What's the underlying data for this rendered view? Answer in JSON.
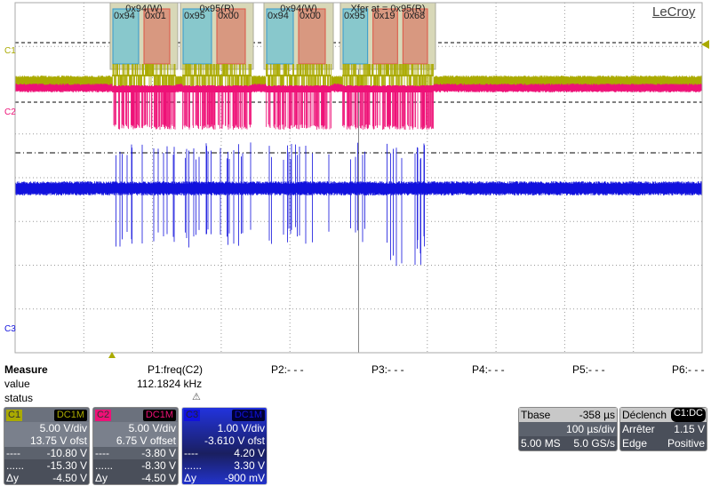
{
  "brand": "LeCroy",
  "channels": [
    {
      "id": "C1",
      "color": "#aaaa00",
      "coupling": "DC1M",
      "vdiv": "5.00 V/div",
      "offset": "13.75 V ofst",
      "cursor1": "-10.80 V",
      "cursor2": "-15.30 V",
      "dy": "-4.50 V"
    },
    {
      "id": "C2",
      "color": "#ee1177",
      "coupling": "DC1M",
      "vdiv": "5.00 V/div",
      "offset": "6.75 V offset",
      "cursor1": "-3.80 V",
      "cursor2": "-8.30 V",
      "dy": "-4.50 V"
    },
    {
      "id": "C3",
      "color": "#1111dd",
      "coupling": "DC1M",
      "vdiv": "1.00 V/div",
      "offset": "-3.610 V ofst",
      "cursor1": "4.20 V",
      "cursor2": "3.30 V",
      "dy": "-900 mV"
    }
  ],
  "cursor_symbols": {
    "dash": "----",
    "dot": "......",
    "delta": "Δy"
  },
  "decode": [
    {
      "label": "0x94(W)",
      "bytes": [
        "0x94",
        "0x01"
      ]
    },
    {
      "label": "0x95(R)",
      "bytes": [
        "0x95",
        "0x00"
      ]
    },
    {
      "label": "0x94(W)",
      "bytes": [
        "0x94",
        "0x00"
      ]
    },
    {
      "label": "Xfer at = 0x95(R)",
      "bytes": [
        "0x95",
        "0x19",
        "0x68"
      ]
    }
  ],
  "measure": {
    "title": "Measure",
    "value_label": "value",
    "status_label": "status",
    "params": [
      {
        "name": "P1:freq(C2)",
        "value": "112.1824 kHz",
        "status": "warning"
      },
      {
        "name": "P2:- - -"
      },
      {
        "name": "P3:- - -"
      },
      {
        "name": "P4:- - -"
      },
      {
        "name": "P5:- - -"
      },
      {
        "name": "P6:- - -"
      }
    ]
  },
  "timebase": {
    "label": "Tbase",
    "delay": "-358 µs",
    "tdiv": "100 µs/div",
    "samples": "5.00 MS",
    "rate": "5.0 GS/s"
  },
  "trigger": {
    "label": "Déclench",
    "source": "C1:DC",
    "mode": "Arrêter",
    "level": "1.15 V",
    "type": "Edge",
    "slope": "Positive"
  }
}
